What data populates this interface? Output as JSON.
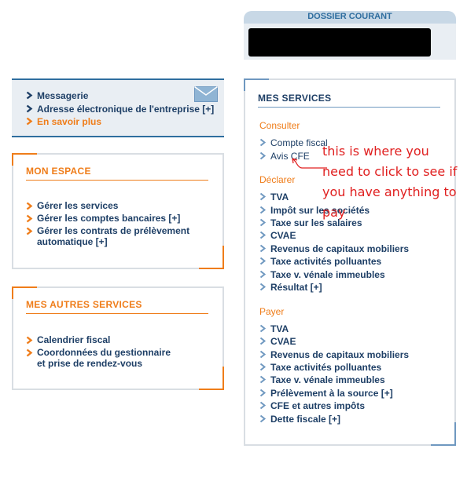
{
  "dossier": {
    "title": "DOSSIER COURANT"
  },
  "top_links": {
    "messagerie": "Messagerie",
    "adresse": "Adresse électronique de l'entreprise [+]",
    "en_savoir": "En savoir plus"
  },
  "mon_espace": {
    "title": "MON ESPACE",
    "items": [
      "Gérer les services",
      "Gérer les comptes bancaires [+]",
      "Gérer les contrats de prélèvement",
      "automatique [+]"
    ]
  },
  "autres": {
    "title": "MES AUTRES SERVICES",
    "items": [
      "Calendrier fiscal",
      "Coordonnées du gestionnaire",
      "et prise de rendez-vous"
    ]
  },
  "services": {
    "title": "MES SERVICES",
    "consulter": {
      "label": "Consulter",
      "items": [
        "Compte fiscal",
        "Avis CFE"
      ]
    },
    "declarer": {
      "label": "Déclarer",
      "items": [
        "TVA",
        "Impôt sur les sociétés",
        "Taxe sur les salaires",
        "CVAE",
        "Revenus de capitaux mobiliers",
        "Taxe activités polluantes",
        "Taxe v. vénale immeubles",
        "Résultat [+]"
      ]
    },
    "payer": {
      "label": "Payer",
      "items": [
        "TVA",
        "CVAE",
        "Revenus de capitaux mobiliers",
        "Taxe activités polluantes",
        "Taxe v. vénale immeubles",
        "Prélèvement à la source [+]",
        "CFE et autres impôts",
        "Dette fiscale [+]"
      ]
    }
  },
  "annotation": {
    "line1": "this is where you",
    "line2": "need to click to see if",
    "line3": "you have anything to",
    "line4": "pay"
  },
  "colors": {
    "navy": "#1e3f66",
    "orange": "#ef7d1a",
    "annotation": "#e02020"
  }
}
